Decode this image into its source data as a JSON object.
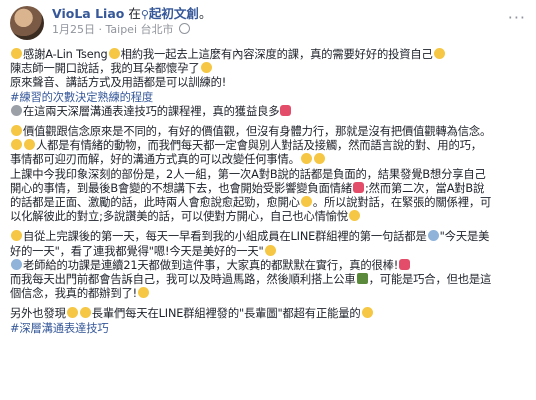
{
  "author": {
    "name": "VioLa Liao",
    "at": "在",
    "place": "起初文創",
    "punct": "。"
  },
  "post_meta": {
    "date": "1月25日",
    "sep": "·",
    "location": "Taipei 台北市"
  },
  "lines": {
    "l1a": "感謝A-Lin Tseng",
    "l1b": "相約我一起去上這麼有內容深度的課，真的需要好好的投資自己",
    "l2": "陳志師一開口說話，我的耳朵都懷孕了",
    "l3": "原來聲音、講話方式及用語都是可以訓練的!",
    "l4": "#練習的次數決定熟練的程度",
    "l5a": "在這兩天深層溝通表達技巧的課程裡，真的獲益良多",
    "l6": "價值觀跟信念原來是不同的，有好的價值觀，但沒有身體力行，那就是沒有把價值觀轉為信念。",
    "l7": "人都是有情緒的動物，而我們每天都一定會與別人對話及接觸，然而語言說的對、用的巧，",
    "l8": "事情都可迎刃而解，好的溝通方式真的可以改變任何事情。",
    "l9": "上課中今我印象深刻的部份是，2人一組，第一次A對B說的話都是負面的，結果發覺B想分享自己",
    "l10": "開心的事情，到最後B會變的不想講下去，也會開始受影響變負面情緒",
    "l10b": ";然而第二次，當A對B說",
    "l11": "的話都是正面、激勵的話，此時兩人會愈說愈起勁，愈開心",
    "l11b": "。所以說對話，在緊張的關係裡，可",
    "l12": "以化解彼此的對立;多說讚美的話，可以使對方開心，自己也心情愉悅",
    "l13a": "自從上完課後的第一天，每天一早看到我的小組成員在LINE群組裡的第一句話都是",
    "l13b": "\"今天是美",
    "l14": "好的一天\"，看了連我都覺得\"嗯!今天是美好的一天\"",
    "l15": "老師給的功課是連續21天都做到這件事，大家真的都默默在實行，真的很棒!",
    "l16a": "而我每天出門前都會告訴自己，我可以及時過馬路，然後順利搭上公車",
    "l16b": "，可能是巧合，但也是這",
    "l17": "個信念，我真的都辦到了!",
    "l18a": "另外也發現",
    "l18b": "長輩們每天在LINE群組裡發的\"長輩圖\"都超有正能量的",
    "l19": "#深層溝通表達技巧"
  },
  "icons": {
    "menu": "more-icon",
    "globe": "globe-icon",
    "pin": "location-pin-icon"
  }
}
